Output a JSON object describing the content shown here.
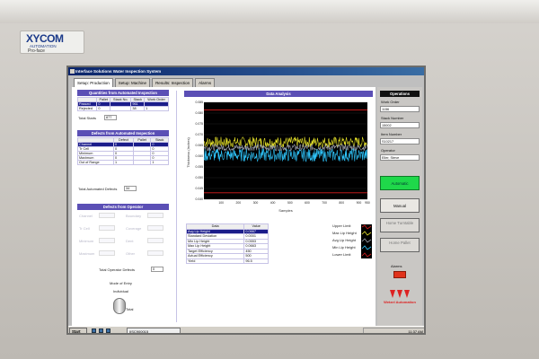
{
  "monitor": {
    "brand_main": "XYCOM",
    "brand_sub": "AUTOMATION",
    "brand_line2": "Pro-face"
  },
  "window": {
    "title": "Interface Solutions Water Inspection System"
  },
  "tabs": [
    {
      "label": "Setup: Production",
      "active": true
    },
    {
      "label": "Setup: Machine",
      "active": false
    },
    {
      "label": "Results: Inspection",
      "active": false
    },
    {
      "label": "Alarms",
      "active": false
    }
  ],
  "quantities": {
    "title": "Quantities from Automated Inspection",
    "columns": [
      "",
      "Pallet",
      "Stack No.",
      "Stack",
      "Work Order"
    ],
    "rows": [
      [
        "Passed",
        "0",
        "",
        "961",
        ""
      ],
      [
        "Rejected",
        "0",
        "",
        "38",
        "1"
      ]
    ],
    "total_label": "Total Starts",
    "total_value": "877"
  },
  "defects_auto": {
    "title": "Defects from Automated Inspection",
    "columns": [
      "",
      "Defect",
      "Pallet",
      "Stack"
    ],
    "rows": [
      [
        "Channel",
        "0",
        "",
        "0"
      ],
      [
        "Tr Cell",
        "0",
        "",
        "0"
      ],
      [
        "Minimum",
        "0",
        "",
        "0"
      ],
      [
        "Maximum",
        "0",
        "",
        "0"
      ],
      [
        "Out of Range",
        "1",
        "",
        "1"
      ]
    ],
    "total_label": "Total Automated Defects",
    "total_value": "34"
  },
  "defects_operator": {
    "title": "Defects from Operator",
    "items": [
      "Channel",
      "Boundary",
      "Tr Cell",
      "Coverage",
      "Minimum",
      "Dent",
      "Maximum",
      "Other"
    ],
    "total_label": "Total Operator Defects",
    "total_value": "0"
  },
  "mode": {
    "label": "Mode of Entry",
    "value_individual": "Individual",
    "value_total": "Total"
  },
  "chart_data": {
    "type": "line",
    "title": "Data Analysis",
    "ylabel": "Thickness (Inches)",
    "xlabel": "Samples",
    "ylim": [
      0.04,
      0.085
    ],
    "xlim": [
      0,
      950
    ],
    "yticks": [
      "0.085",
      "0.080",
      "0.075",
      "0.070",
      "0.065",
      "0.060",
      "0.055",
      "0.050",
      "0.045",
      "0.040"
    ],
    "xticks": [
      "100",
      "200",
      "300",
      "400",
      "500",
      "600",
      "700",
      "800",
      "900",
      "950"
    ],
    "series": [
      {
        "name": "Upper Limit",
        "color": "#d81d1d",
        "constant": 0.0815
      },
      {
        "name": "Max Lip Height",
        "color": "#e6e22a",
        "baseline": 0.0665,
        "amplitude": 0.0025
      },
      {
        "name": "Avg Lip Height",
        "color": "#9fa3b0",
        "baseline": 0.064,
        "amplitude": 0.0015
      },
      {
        "name": "Min Lip Height",
        "color": "#2fc8ff",
        "baseline": 0.0605,
        "amplitude": 0.003
      },
      {
        "name": "Lower Limit",
        "color": "#d81d1d",
        "constant": 0.043
      }
    ]
  },
  "readout": {
    "headers": [
      "Data",
      "Value"
    ],
    "rows": [
      [
        "Avg Lip Height",
        "0.0667"
      ],
      [
        "Standard Deviation",
        "0.0001"
      ],
      [
        "Min Lip Height",
        "0.0553"
      ],
      [
        "Max Lip Height",
        "0.0663"
      ],
      [
        "Target Efficiency",
        "450"
      ],
      [
        "Actual Efficiency",
        "500"
      ],
      [
        "Yield",
        "96.5"
      ]
    ]
  },
  "legend": [
    "Upper Limit",
    "Max Lip Height",
    "Avg Lip Height",
    "Min Lip Height",
    "Lower Limit"
  ],
  "operations": {
    "title": "Operations",
    "work_order_label": "Work Order",
    "work_order_value": "1156",
    "stack_number_label": "Stack Number",
    "stack_number_value": "15002",
    "item_number_label": "Item Number",
    "item_number_value": "S10217",
    "operator_label": "Operator",
    "operator_value": "Eller, Steve",
    "automatic_label": "Automatic",
    "manual_label": "Manual",
    "home_turntable_label": "Home Turntable",
    "home_pallet_label": "Home Pallet",
    "alarms_label": "Alarms",
    "vendor_label": "Wetzel Automation"
  },
  "taskbar": {
    "start_label": "Start",
    "task_label": "IISC900015",
    "time": "11:37 AM"
  }
}
